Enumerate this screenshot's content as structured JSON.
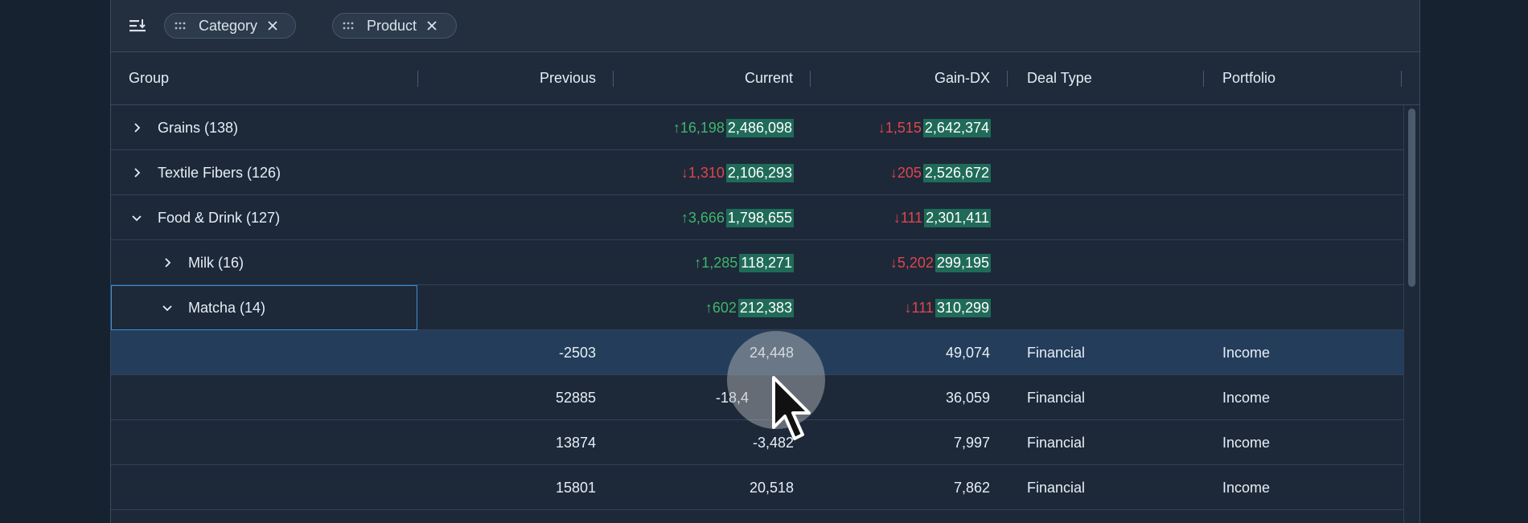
{
  "toolbar": {
    "group_icon": "row-group-icon",
    "chips": [
      {
        "label": "Category"
      },
      {
        "label": "Product"
      }
    ]
  },
  "columns": {
    "group": "Group",
    "previous": "Previous",
    "current": "Current",
    "gain": "Gain-DX",
    "deal_type": "Deal Type",
    "portfolio": "Portfolio"
  },
  "rows": [
    {
      "label": "Grains (138)",
      "expanded": false,
      "current_delta": "↑16,198",
      "current_value": "2,486,098",
      "gain_delta": "↓1,515",
      "gain_value": "2,642,374"
    },
    {
      "label": "Textile Fibers (126)",
      "expanded": false,
      "current_delta": "↓1,310",
      "current_value": "2,106,293",
      "gain_delta": "↓205",
      "gain_value": "2,526,672"
    },
    {
      "label": "Food & Drink (127)",
      "expanded": true,
      "current_delta": "↑3,666",
      "current_value": "1,798,655",
      "gain_delta": "↓111",
      "gain_value": "2,301,411"
    },
    {
      "label": "Milk (16)",
      "expanded": false,
      "current_delta": "↑1,285",
      "current_value": "118,271",
      "gain_delta": "↓5,202",
      "gain_value": "299,195"
    },
    {
      "label": "Matcha (14)",
      "expanded": true,
      "current_delta": "↑602",
      "current_value": "212,383",
      "gain_delta": "↓111",
      "gain_value": "310,299"
    }
  ],
  "leaf_rows": [
    {
      "previous": "-2503",
      "current": "24,448",
      "gain": "49,074",
      "deal_type": "Financial",
      "portfolio": "Income"
    },
    {
      "previous": "52885",
      "current": "-18,4",
      "gain": "36,059",
      "deal_type": "Financial",
      "portfolio": "Income"
    },
    {
      "previous": "13874",
      "current": "-3,482",
      "gain": "7,997",
      "deal_type": "Financial",
      "portfolio": "Income"
    },
    {
      "previous": "15801",
      "current": "20,518",
      "gain": "7,862",
      "deal_type": "Financial",
      "portfolio": "Income"
    }
  ],
  "colors": {
    "up": "#3fb56b",
    "down": "#e0444b",
    "value_highlight": "#1f6b58",
    "selected_row": "#243d5a",
    "focus_border": "#3d8fd6"
  }
}
